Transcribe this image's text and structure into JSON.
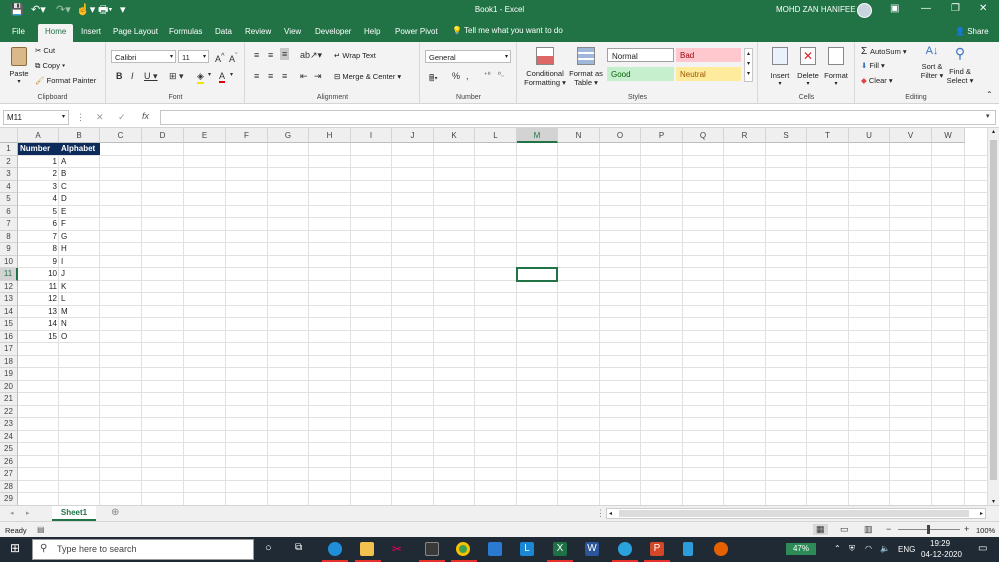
{
  "window": {
    "title": "Book1  -  Excel",
    "user": "MOHD ZAN HANIFEE"
  },
  "ribbon_tabs": [
    "File",
    "Home",
    "Insert",
    "Page Layout",
    "Formulas",
    "Data",
    "Review",
    "View",
    "Developer",
    "Help",
    "Power Pivot"
  ],
  "tell_me": "Tell me what you want to do",
  "share": "Share",
  "clipboard": {
    "paste": "Paste",
    "cut": "Cut",
    "copy": "Copy",
    "format_painter": "Format Painter",
    "label": "Clipboard"
  },
  "font": {
    "name": "Calibri",
    "size": "11",
    "label": "Font"
  },
  "alignment": {
    "wrap": "Wrap Text",
    "merge": "Merge & Center",
    "label": "Alignment"
  },
  "number": {
    "format": "General",
    "label": "Number",
    "percent": "%"
  },
  "styles": {
    "cond": "Conditional",
    "cond2": "Formatting",
    "fmt_table": "Format as",
    "fmt_table2": "Table",
    "normal": "Normal",
    "bad": "Bad",
    "good": "Good",
    "neutral": "Neutral",
    "label": "Styles"
  },
  "cells": {
    "insert": "Insert",
    "delete": "Delete",
    "format": "Format",
    "label": "Cells"
  },
  "editing": {
    "autosum": "AutoSum",
    "fill": "Fill",
    "clear": "Clear",
    "sort": "Sort &",
    "sort2": "Filter",
    "find": "Find &",
    "find2": "Select",
    "label": "Editing"
  },
  "namebox": "M11",
  "columns": [
    "A",
    "B",
    "C",
    "D",
    "E",
    "F",
    "G",
    "H",
    "I",
    "J",
    "K",
    "L",
    "M",
    "N",
    "O",
    "P",
    "Q",
    "R",
    "S",
    "T",
    "U",
    "V",
    "W"
  ],
  "rows": [
    "1",
    "2",
    "3",
    "4",
    "5",
    "6",
    "7",
    "8",
    "9",
    "10",
    "11",
    "12",
    "13",
    "14",
    "15",
    "16",
    "17",
    "18",
    "19",
    "20",
    "21",
    "22",
    "23",
    "24",
    "25",
    "26",
    "27",
    "28",
    "29"
  ],
  "table": {
    "headers": [
      "Number",
      "Alphabet"
    ],
    "rows": [
      [
        "1",
        "A"
      ],
      [
        "2",
        "B"
      ],
      [
        "3",
        "C"
      ],
      [
        "4",
        "D"
      ],
      [
        "5",
        "E"
      ],
      [
        "6",
        "F"
      ],
      [
        "7",
        "G"
      ],
      [
        "8",
        "H"
      ],
      [
        "9",
        "I"
      ],
      [
        "10",
        "J"
      ],
      [
        "11",
        "K"
      ],
      [
        "12",
        "L"
      ],
      [
        "13",
        "M"
      ],
      [
        "14",
        "N"
      ],
      [
        "15",
        "O"
      ]
    ]
  },
  "sheet": "Sheet1",
  "status": {
    "ready": "Ready",
    "zoom": "100%"
  },
  "taskbar": {
    "search": "Type here to search",
    "battery": "47%",
    "lang": "ENG",
    "time": "19:29",
    "date": "04-12-2020"
  },
  "colors": {
    "excel_green": "#217346",
    "header_fill": "#0c2a5a"
  }
}
